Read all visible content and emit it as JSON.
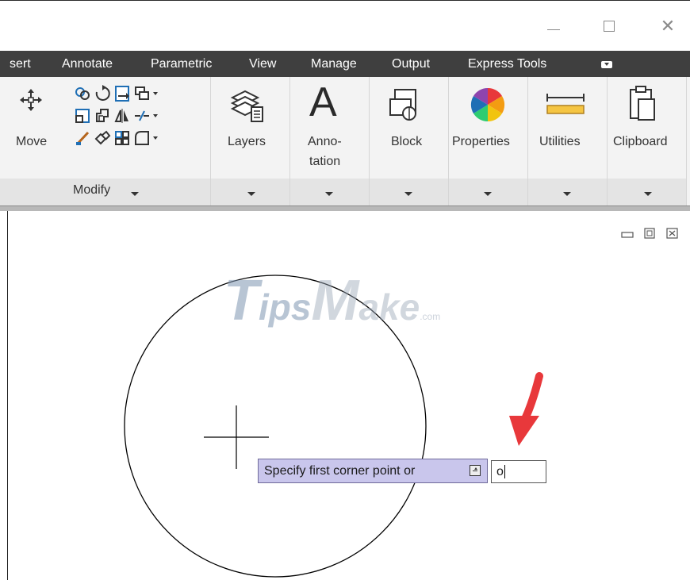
{
  "window": {
    "minimize_glyph": "—",
    "maximize_glyph": "☐",
    "close_glyph": "✕"
  },
  "tabs": [
    "sert",
    "Annotate",
    "Parametric",
    "View",
    "Manage",
    "Output",
    "Express Tools"
  ],
  "ribbon": {
    "move_label": "Move",
    "modify_panel_title": "Modify",
    "layers_label": "Layers",
    "annotation_label_1": "Anno-",
    "annotation_label_2": "tation",
    "annotation_letter": "A",
    "block_label": "Block",
    "properties_label": "Properties",
    "utilities_label": "Utilities",
    "clipboard_label": "Clipboard"
  },
  "watermark": {
    "t": "T",
    "ips": "ips",
    "m": "M",
    "ake": "ake",
    "com": ".com"
  },
  "command": {
    "prompt": "Specify first corner point or",
    "input_value": "o"
  },
  "colors": {
    "tab_bar": "#3f3f3f",
    "ribbon_bg": "#f3f3f3",
    "tooltip_bg": "#c9c6ec",
    "arrow_red": "#e8383b"
  }
}
